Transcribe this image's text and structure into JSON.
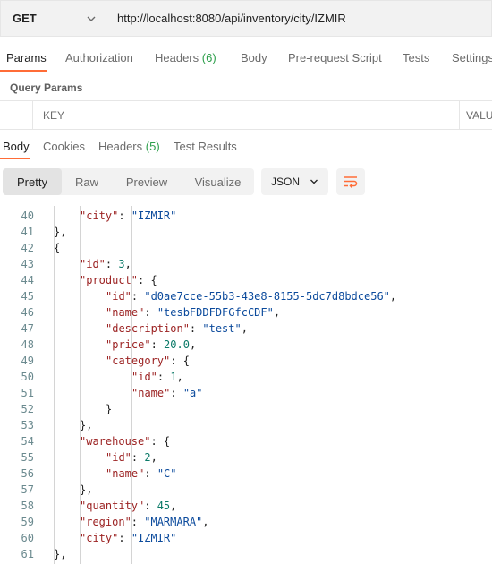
{
  "request": {
    "method": "GET",
    "url": "http://localhost:8080/api/inventory/city/IZMIR"
  },
  "request_tabs": [
    {
      "label": "Params",
      "count": ""
    },
    {
      "label": "Authorization",
      "count": ""
    },
    {
      "label": "Headers",
      "count": "(6)"
    },
    {
      "label": "Body",
      "count": ""
    },
    {
      "label": "Pre-request Script",
      "count": ""
    },
    {
      "label": "Tests",
      "count": ""
    },
    {
      "label": "Settings",
      "count": ""
    }
  ],
  "query_params": {
    "title": "Query Params",
    "columns": [
      "KEY",
      "VALUE"
    ]
  },
  "response_tabs": [
    {
      "label": "Body",
      "count": ""
    },
    {
      "label": "Cookies",
      "count": ""
    },
    {
      "label": "Headers",
      "count": "(5)"
    },
    {
      "label": "Test Results",
      "count": ""
    }
  ],
  "view_modes": [
    "Pretty",
    "Raw",
    "Preview",
    "Visualize"
  ],
  "format": "JSON",
  "colors": {
    "accent": "#ff6c37",
    "count": "#2e9f4c",
    "json_key": "#9c2323",
    "json_string": "#0b4a9c",
    "json_number": "#0b7a68"
  },
  "icons": [
    "chevron-down-icon",
    "wrap-lines-icon"
  ],
  "code_lines": [
    {
      "n": "40",
      "indent": 2,
      "parts": [
        {
          "t": "\"city\"",
          "c": "k"
        },
        {
          "t": ": ",
          "c": ""
        },
        {
          "t": "\"IZMIR\"",
          "c": "s"
        }
      ]
    },
    {
      "n": "41",
      "indent": 1,
      "parts": [
        {
          "t": "},",
          "c": ""
        }
      ]
    },
    {
      "n": "42",
      "indent": 1,
      "parts": [
        {
          "t": "{",
          "c": ""
        }
      ]
    },
    {
      "n": "43",
      "indent": 2,
      "parts": [
        {
          "t": "\"id\"",
          "c": "k"
        },
        {
          "t": ": ",
          "c": ""
        },
        {
          "t": "3",
          "c": "n"
        },
        {
          "t": ",",
          "c": ""
        }
      ]
    },
    {
      "n": "44",
      "indent": 2,
      "parts": [
        {
          "t": "\"product\"",
          "c": "k"
        },
        {
          "t": ": {",
          "c": ""
        }
      ]
    },
    {
      "n": "45",
      "indent": 3,
      "parts": [
        {
          "t": "\"id\"",
          "c": "k"
        },
        {
          "t": ": ",
          "c": ""
        },
        {
          "t": "\"d0ae7cce-55b3-43e8-8155-5dc7d8bdce56\"",
          "c": "s"
        },
        {
          "t": ",",
          "c": ""
        }
      ]
    },
    {
      "n": "46",
      "indent": 3,
      "parts": [
        {
          "t": "\"name\"",
          "c": "k"
        },
        {
          "t": ": ",
          "c": ""
        },
        {
          "t": "\"tesbFDDFDFGfcCDF\"",
          "c": "s"
        },
        {
          "t": ",",
          "c": ""
        }
      ]
    },
    {
      "n": "47",
      "indent": 3,
      "parts": [
        {
          "t": "\"description\"",
          "c": "k"
        },
        {
          "t": ": ",
          "c": ""
        },
        {
          "t": "\"test\"",
          "c": "s"
        },
        {
          "t": ",",
          "c": ""
        }
      ]
    },
    {
      "n": "48",
      "indent": 3,
      "parts": [
        {
          "t": "\"price\"",
          "c": "k"
        },
        {
          "t": ": ",
          "c": ""
        },
        {
          "t": "20.0",
          "c": "n"
        },
        {
          "t": ",",
          "c": ""
        }
      ]
    },
    {
      "n": "49",
      "indent": 3,
      "parts": [
        {
          "t": "\"category\"",
          "c": "k"
        },
        {
          "t": ": {",
          "c": ""
        }
      ]
    },
    {
      "n": "50",
      "indent": 4,
      "parts": [
        {
          "t": "\"id\"",
          "c": "k"
        },
        {
          "t": ": ",
          "c": ""
        },
        {
          "t": "1",
          "c": "n"
        },
        {
          "t": ",",
          "c": ""
        }
      ]
    },
    {
      "n": "51",
      "indent": 4,
      "parts": [
        {
          "t": "\"name\"",
          "c": "k"
        },
        {
          "t": ": ",
          "c": ""
        },
        {
          "t": "\"a\"",
          "c": "s"
        }
      ]
    },
    {
      "n": "52",
      "indent": 3,
      "parts": [
        {
          "t": "}",
          "c": ""
        }
      ]
    },
    {
      "n": "53",
      "indent": 2,
      "parts": [
        {
          "t": "},",
          "c": ""
        }
      ]
    },
    {
      "n": "54",
      "indent": 2,
      "parts": [
        {
          "t": "\"warehouse\"",
          "c": "k"
        },
        {
          "t": ": {",
          "c": ""
        }
      ]
    },
    {
      "n": "55",
      "indent": 3,
      "parts": [
        {
          "t": "\"id\"",
          "c": "k"
        },
        {
          "t": ": ",
          "c": ""
        },
        {
          "t": "2",
          "c": "n"
        },
        {
          "t": ",",
          "c": ""
        }
      ]
    },
    {
      "n": "56",
      "indent": 3,
      "parts": [
        {
          "t": "\"name\"",
          "c": "k"
        },
        {
          "t": ": ",
          "c": ""
        },
        {
          "t": "\"C\"",
          "c": "s"
        }
      ]
    },
    {
      "n": "57",
      "indent": 2,
      "parts": [
        {
          "t": "},",
          "c": ""
        }
      ]
    },
    {
      "n": "58",
      "indent": 2,
      "parts": [
        {
          "t": "\"quantity\"",
          "c": "k"
        },
        {
          "t": ": ",
          "c": ""
        },
        {
          "t": "45",
          "c": "n"
        },
        {
          "t": ",",
          "c": ""
        }
      ]
    },
    {
      "n": "59",
      "indent": 2,
      "parts": [
        {
          "t": "\"region\"",
          "c": "k"
        },
        {
          "t": ": ",
          "c": ""
        },
        {
          "t": "\"MARMARA\"",
          "c": "s"
        },
        {
          "t": ",",
          "c": ""
        }
      ]
    },
    {
      "n": "60",
      "indent": 2,
      "parts": [
        {
          "t": "\"city\"",
          "c": "k"
        },
        {
          "t": ": ",
          "c": ""
        },
        {
          "t": "\"IZMIR\"",
          "c": "s"
        }
      ]
    },
    {
      "n": "61",
      "indent": 1,
      "parts": [
        {
          "t": "},",
          "c": ""
        }
      ]
    }
  ]
}
